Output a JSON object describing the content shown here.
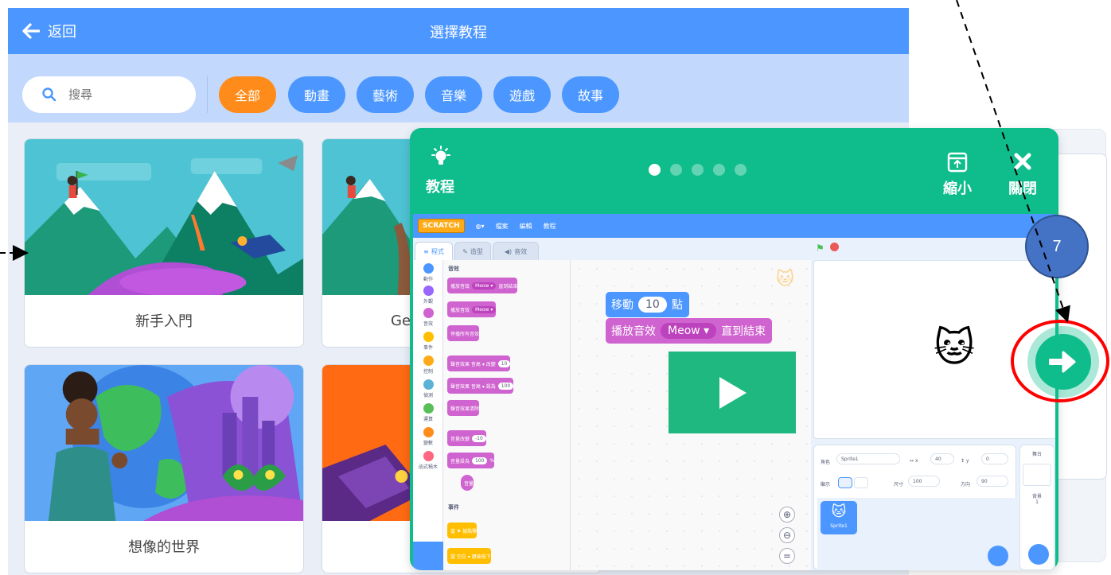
{
  "header": {
    "back_label": "返回",
    "title": "選擇教程"
  },
  "search": {
    "placeholder": "搜尋"
  },
  "filters": [
    {
      "label": "全部",
      "active": true
    },
    {
      "label": "動畫",
      "active": false
    },
    {
      "label": "藝術",
      "active": false
    },
    {
      "label": "音樂",
      "active": false
    },
    {
      "label": "遊戲",
      "active": false
    },
    {
      "label": "故事",
      "active": false
    }
  ],
  "cards": [
    {
      "label": "新手入門"
    },
    {
      "label": "Get"
    },
    {
      "label": "想像的世界"
    },
    {
      "label": ""
    }
  ],
  "tutorial": {
    "title": "教程",
    "step_count": 5,
    "current_step": 1,
    "shrink_label": "縮小",
    "close_label": "關閉"
  },
  "editor": {
    "logo": "SCRATCH",
    "menu": [
      "檔案",
      "編輯",
      "教程"
    ],
    "tabs": [
      "程式",
      "造型",
      "音效"
    ],
    "categories": [
      "動作",
      "外觀",
      "音效",
      "事件",
      "控制",
      "偵測",
      "運算",
      "變數",
      "函式積木"
    ],
    "sound_header": "音效",
    "palette_blocks": [
      {
        "text": "播放音效",
        "value": "Meow ▾",
        "suffix": "直到結束"
      },
      {
        "text": "播放音效",
        "value": "Meow ▾",
        "suffix": ""
      },
      {
        "text": "停播所有音效",
        "value": "",
        "suffix": ""
      },
      {
        "text": "聲音效果 音高 ▾ 改變",
        "value": "10",
        "suffix": ""
      },
      {
        "text": "聲音效果 音高 ▾ 設為",
        "value": "100",
        "suffix": ""
      },
      {
        "text": "聲音效果清除",
        "value": "",
        "suffix": ""
      },
      {
        "text": "音量改變",
        "value": "-10",
        "suffix": ""
      },
      {
        "text": "音量設為",
        "value": "100",
        "suffix": "%"
      },
      {
        "text": "音量",
        "value": "",
        "suffix": ""
      }
    ],
    "events_header": "事件",
    "event_blocks": [
      "當 ⚑ 被點擊",
      "當 空白 ▾ 鍵被按下"
    ],
    "workspace_move": {
      "text": "移動",
      "value": "10",
      "suffix": "點"
    },
    "workspace_sound": {
      "text": "播放音效",
      "value": "Meow ▾",
      "suffix": "直到結束"
    },
    "sprite": {
      "role_label": "角色",
      "name": "Sprite1",
      "x_label": "x",
      "x": "40",
      "y_label": "y",
      "y": "0",
      "show_label": "顯示",
      "size_label": "尺寸",
      "size": "100",
      "direction_label": "方向",
      "direction": "90",
      "thumb_label": "Sprite1"
    },
    "stage_side": {
      "title": "舞台",
      "backdrop_label": "背景",
      "backdrop_count": "1"
    }
  },
  "annotation": {
    "step_number": "7"
  },
  "colors": {
    "header_blue": "#4c97ff",
    "filter_bar": "#c2d9fd",
    "active_chip": "#ff8c1a",
    "tutorial_green": "#0fbd8c",
    "marker_blue": "#4472c4",
    "highlight_red": "#ff0000"
  }
}
